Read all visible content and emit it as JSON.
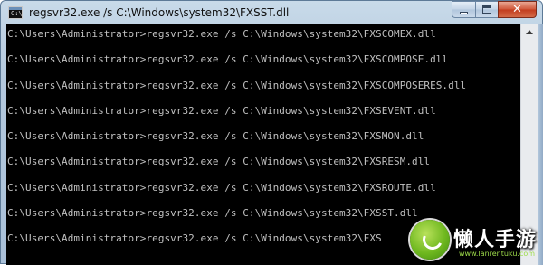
{
  "window": {
    "title": "regsvr32.exe  /s C:\\Windows\\system32\\FXSST.dll",
    "icon": "console-app-icon",
    "controls": {
      "minimize_icon": "minimize-icon",
      "maximize_icon": "maximize-icon",
      "close_label": "✕"
    }
  },
  "console": {
    "lines": [
      "C:\\Users\\Administrator>regsvr32.exe /s C:\\Windows\\system32\\FXSCOMEX.dll",
      "C:\\Users\\Administrator>regsvr32.exe /s C:\\Windows\\system32\\FXSCOMPOSE.dll",
      "C:\\Users\\Administrator>regsvr32.exe /s C:\\Windows\\system32\\FXSCOMPOSERES.dll",
      "C:\\Users\\Administrator>regsvr32.exe /s C:\\Windows\\system32\\FXSEVENT.dll",
      "C:\\Users\\Administrator>regsvr32.exe /s C:\\Windows\\system32\\FXSMON.dll",
      "C:\\Users\\Administrator>regsvr32.exe /s C:\\Windows\\system32\\FXSRESM.dll",
      "C:\\Users\\Administrator>regsvr32.exe /s C:\\Windows\\system32\\FXSROUTE.dll",
      "C:\\Users\\Administrator>regsvr32.exe /s C:\\Windows\\system32\\FXSST.dll",
      "C:\\Users\\Administrator>regsvr32.exe /s C:\\Windows\\system32\\FXS"
    ],
    "colors": {
      "background": "#000000",
      "text": "#c0c0c0"
    }
  },
  "watermark": {
    "text": "懒人手游",
    "url": "www.lanrentuku.com"
  }
}
